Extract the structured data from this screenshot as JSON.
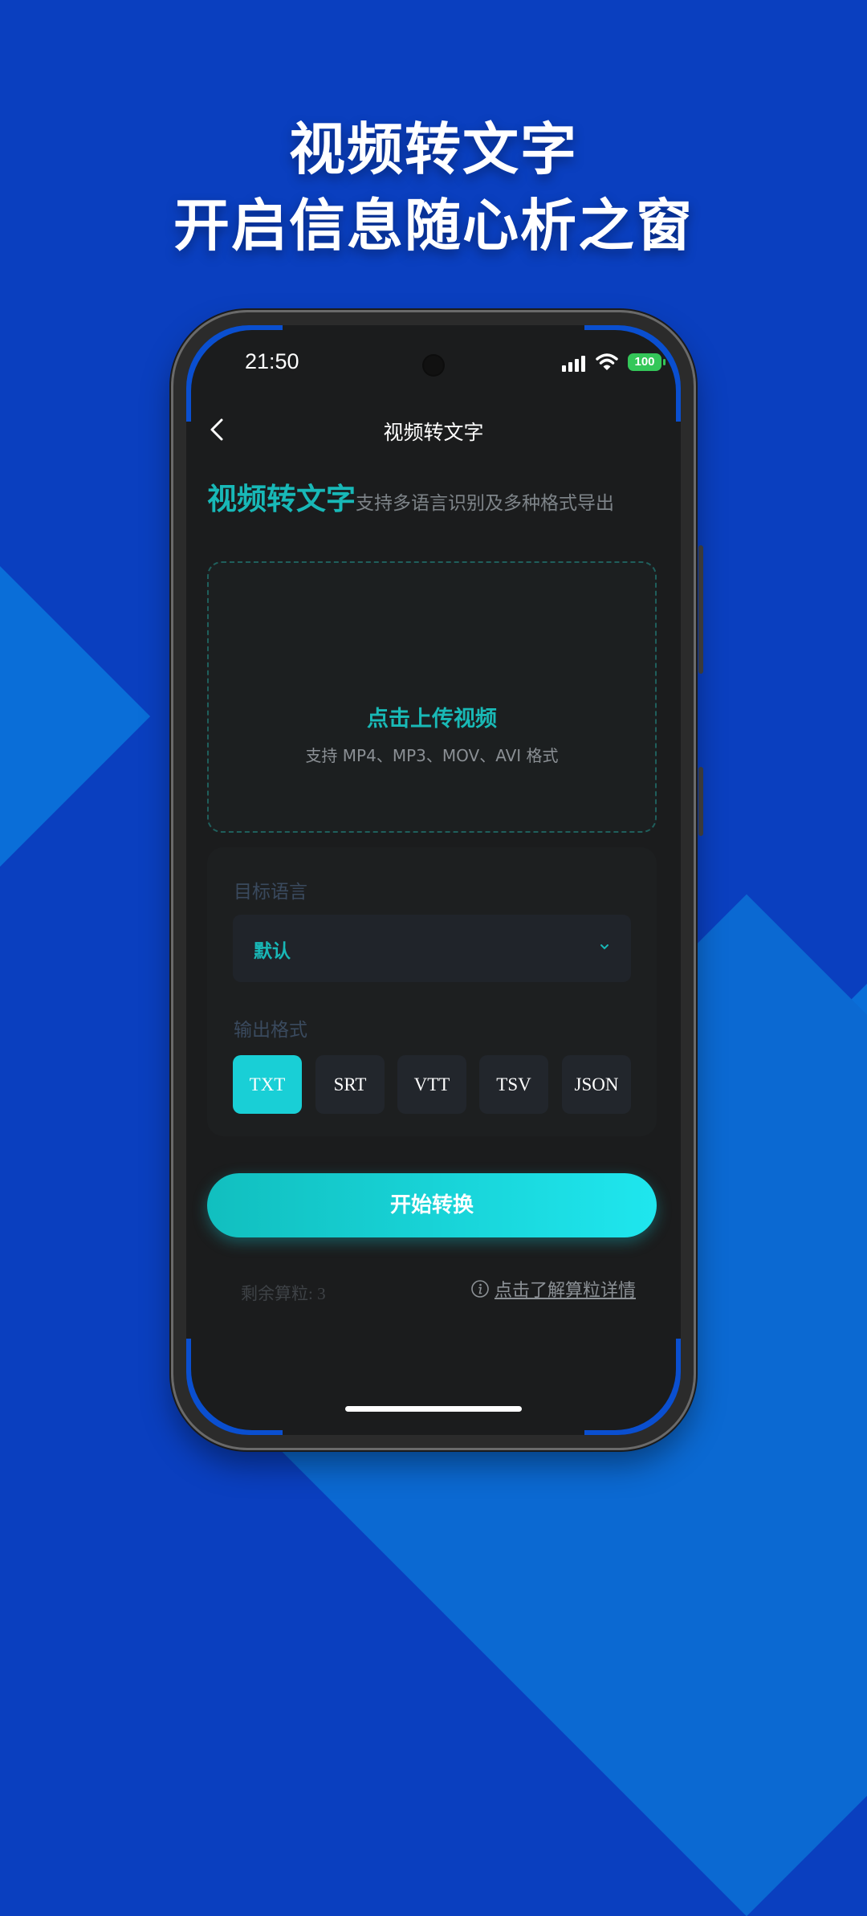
{
  "promo": {
    "line1": "视频转文字",
    "line2": "开启信息随心析之窗"
  },
  "status_bar": {
    "time": "21:50",
    "battery": "100",
    "icons": [
      "signal-icon",
      "wifi-icon",
      "battery-icon"
    ]
  },
  "nav": {
    "title": "视频转文字",
    "back_icon": "chevron-left-icon"
  },
  "hero": {
    "title": "视频转文字",
    "subtitle": "支持多语言识别及多种格式导出"
  },
  "upload": {
    "title": "点击上传视频",
    "subtitle": "支持 MP4、MP3、MOV、AVI 格式"
  },
  "settings": {
    "language_label": "目标语言",
    "language_value": "默认",
    "format_label": "输出格式",
    "formats": [
      "TXT",
      "SRT",
      "VTT",
      "TSV",
      "JSON"
    ],
    "selected_format": "TXT"
  },
  "actions": {
    "start_label": "开始转换",
    "remaining": "剩余算粒: 3",
    "learn_more": "点击了解算粒详情"
  },
  "colors": {
    "accent": "#18B8B7",
    "screen_bg": "#1B1C1D",
    "promo_bg": "#0A3FBF",
    "button_gradient_start": "#11BFBF",
    "button_gradient_end": "#1FE6EE"
  }
}
